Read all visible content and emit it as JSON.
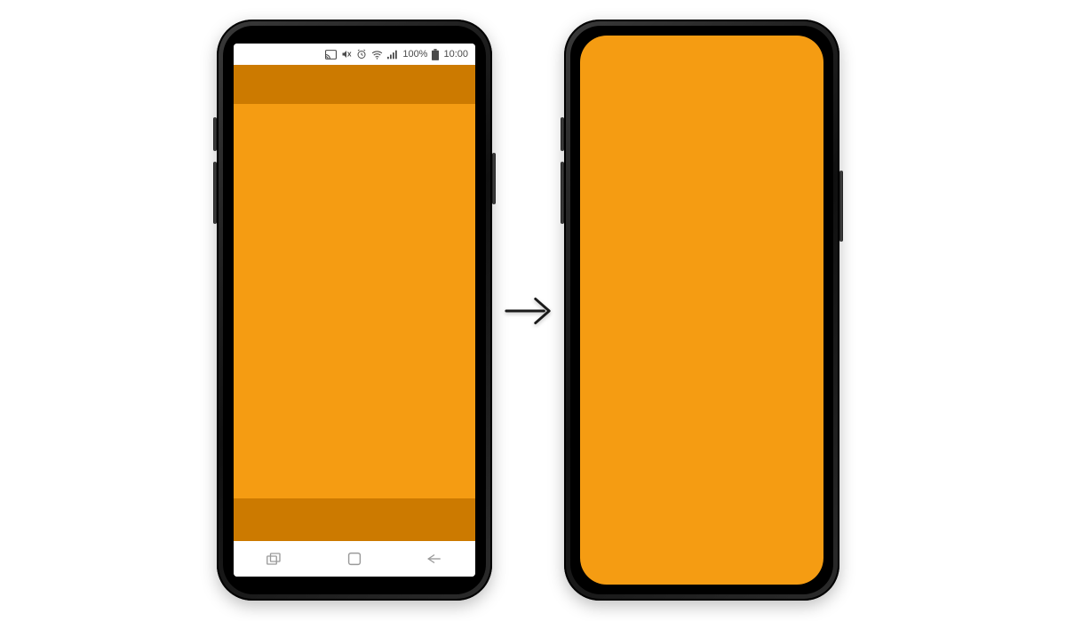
{
  "colors": {
    "screen_bg": "#f59c12",
    "band_bg": "#cc7a00",
    "frame": "#111111",
    "system_ui_bg": "#ffffff",
    "system_ui_fg": "#4a4a4a"
  },
  "left_phone": {
    "statusbar": {
      "icons": [
        "cast-icon",
        "mute-icon",
        "alarm-icon",
        "wifi-icon",
        "signal-icon"
      ],
      "battery_pct": "100%",
      "time": "10:00"
    },
    "navbar": {
      "buttons": [
        "recent-apps",
        "home",
        "back"
      ]
    }
  },
  "right_phone": {
    "fullscreen": true
  },
  "arrow_label": "transforms to"
}
